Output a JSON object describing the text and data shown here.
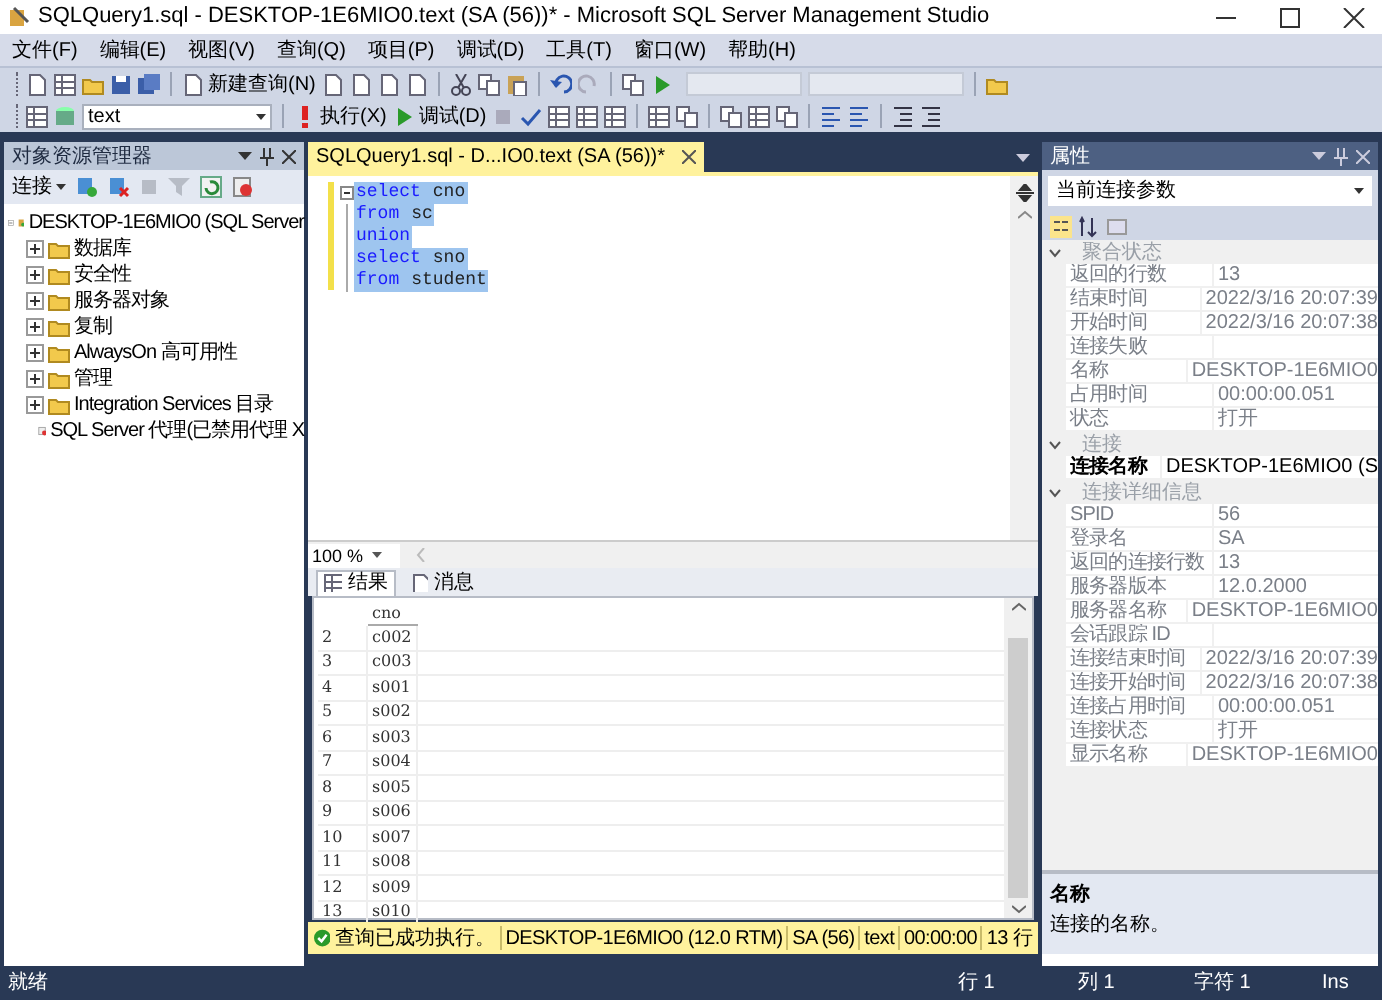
{
  "window": {
    "title": "SQLQuery1.sql - DESKTOP-1E6MIO0.text (SA (56))* - Microsoft SQL Server Management Studio"
  },
  "menu": [
    "文件(F)",
    "编辑(E)",
    "视图(V)",
    "查询(Q)",
    "项目(P)",
    "调试(D)",
    "工具(T)",
    "窗口(W)",
    "帮助(H)"
  ],
  "toolbar": {
    "new_query": "新建查询(N)",
    "database": "text",
    "execute": "执行(X)",
    "debug": "调试(D)"
  },
  "object_explorer": {
    "title": "对象资源管理器",
    "connect": "连接",
    "tree": [
      {
        "label": "DESKTOP-1E6MIO0 (SQL Server",
        "kind": "server",
        "expanded": true,
        "children": [
          {
            "label": "数据库",
            "kind": "folder",
            "expanded": false
          },
          {
            "label": "安全性",
            "kind": "folder",
            "expanded": false
          },
          {
            "label": "服务器对象",
            "kind": "folder",
            "expanded": false
          },
          {
            "label": "复制",
            "kind": "folder",
            "expanded": false
          },
          {
            "label": "AlwaysOn 高可用性",
            "kind": "folder",
            "expanded": false
          },
          {
            "label": "管理",
            "kind": "folder",
            "expanded": false
          },
          {
            "label": "Integration Services 目录",
            "kind": "folder",
            "expanded": false
          },
          {
            "label": "SQL Server 代理(已禁用代理 X",
            "kind": "agent"
          }
        ]
      }
    ]
  },
  "editor": {
    "tab": {
      "label": "SQLQuery1.sql - D...IO0.text (SA (56))*",
      "selected": true
    },
    "lines": [
      [
        {
          "text": "select",
          "kind": "keyword"
        },
        {
          "text": "cno",
          "kind": "name"
        }
      ],
      [
        {
          "text": "from",
          "kind": "keyword"
        },
        {
          "text": "sc",
          "kind": "name"
        }
      ],
      [
        {
          "text": "union",
          "kind": "keyword"
        }
      ],
      [
        {
          "text": "select",
          "kind": "keyword"
        },
        {
          "text": "sno",
          "kind": "name"
        }
      ],
      [
        {
          "text": "from",
          "kind": "keyword"
        },
        {
          "text": "student",
          "kind": "name"
        }
      ]
    ],
    "zoom": "100 %"
  },
  "results": {
    "tabs": [
      {
        "label": "结果",
        "selected": true
      },
      {
        "label": "消息",
        "selected": false
      }
    ],
    "columns": [
      "",
      "cno"
    ],
    "rows": [
      [
        "2",
        "c002"
      ],
      [
        "3",
        "c003"
      ],
      [
        "4",
        "s001"
      ],
      [
        "5",
        "s002"
      ],
      [
        "6",
        "s003"
      ],
      [
        "7",
        "s004"
      ],
      [
        "8",
        "s005"
      ],
      [
        "9",
        "s006"
      ],
      [
        "10",
        "s007"
      ],
      [
        "11",
        "s008"
      ],
      [
        "12",
        "s009"
      ],
      [
        "13",
        "s010"
      ]
    ]
  },
  "query_status": {
    "message": "查询已成功执行。",
    "server": "DESKTOP-1E6MIO0 (12.0 RTM)",
    "user": "SA (56)",
    "database": "text",
    "time": "00:00:00",
    "rows": "13 行"
  },
  "properties": {
    "title": "属性",
    "selector": "当前连接参数",
    "groups": [
      {
        "label": "聚合状态",
        "expanded": true,
        "rows": [
          {
            "name": "返回的行数",
            "value": "13",
            "selected": false
          },
          {
            "name": "结束时间",
            "value": "2022/3/16 20:07:39",
            "selected": false
          },
          {
            "name": "开始时间",
            "value": "2022/3/16 20:07:38",
            "selected": false
          },
          {
            "name": "连接失败",
            "value": "",
            "selected": false
          },
          {
            "name": "名称",
            "value": "DESKTOP-1E6MIO0",
            "selected": false
          },
          {
            "name": "占用时间",
            "value": "00:00:00.051",
            "selected": false
          },
          {
            "name": "状态",
            "value": "打开",
            "selected": false
          }
        ]
      },
      {
        "label": "连接",
        "expanded": true,
        "rows": [
          {
            "name": "连接名称",
            "value": "DESKTOP-1E6MIO0 (S",
            "selected": true
          }
        ]
      },
      {
        "label": "连接详细信息",
        "expanded": true,
        "rows": [
          {
            "name": "SPID",
            "value": "56",
            "selected": false
          },
          {
            "name": "登录名",
            "value": "SA",
            "selected": false
          },
          {
            "name": "返回的连接行数",
            "value": "13",
            "selected": false
          },
          {
            "name": "服务器版本",
            "value": "12.0.2000",
            "selected": false
          },
          {
            "name": "服务器名称",
            "value": "DESKTOP-1E6MIO0",
            "selected": false
          },
          {
            "name": "会话跟踪 ID",
            "value": "",
            "selected": false
          },
          {
            "name": "连接结束时间",
            "value": "2022/3/16 20:07:39",
            "selected": false
          },
          {
            "name": "连接开始时间",
            "value": "2022/3/16 20:07:38",
            "selected": false
          },
          {
            "name": "连接占用时间",
            "value": "00:00:00.051",
            "selected": false
          },
          {
            "name": "连接状态",
            "value": "打开",
            "selected": false
          },
          {
            "name": "显示名称",
            "value": "DESKTOP-1E6MIO0",
            "selected": false
          }
        ]
      }
    ],
    "description": {
      "title": "名称",
      "text": "连接的名称。"
    }
  },
  "status_bar": {
    "message": "就绪",
    "line": "行 1",
    "column": "列 1",
    "char": "字符 1",
    "mode": "Ins"
  }
}
